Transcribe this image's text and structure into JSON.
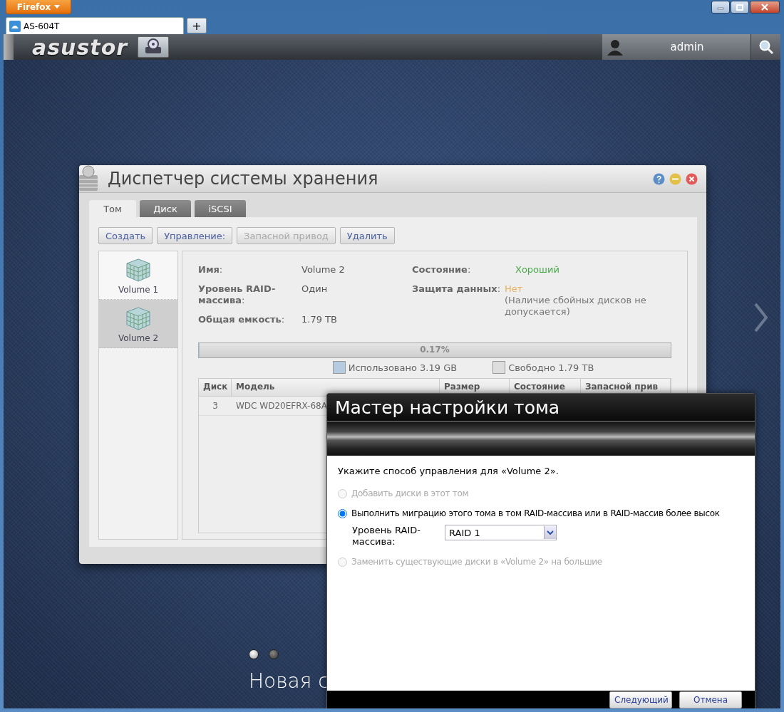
{
  "browser": {
    "menu_button": "Firefox",
    "tabs": [
      {
        "label": "AS-604T",
        "selected": true
      }
    ],
    "new_tab": "+"
  },
  "topbar": {
    "logo": "asustor",
    "user": "admin"
  },
  "storage_window": {
    "title": "Диспетчер системы хранения",
    "tabs": [
      {
        "label": "Том",
        "selected": true
      },
      {
        "label": "Диск",
        "selected": false
      },
      {
        "label": "iSCSI",
        "selected": false
      }
    ],
    "toolbar": [
      {
        "label": "Создать",
        "disabled": false
      },
      {
        "label": "Управление:",
        "disabled": false
      },
      {
        "label": "Запасной привод",
        "disabled": true
      },
      {
        "label": "Удалить",
        "disabled": false
      }
    ],
    "volumes": [
      {
        "label": "Volume 1",
        "selected": false
      },
      {
        "label": "Volume 2",
        "selected": true
      }
    ],
    "details_left": [
      {
        "label": "**Имя**:",
        "value": "Volume 2"
      },
      {
        "label": "**Уровень RAID-массива**:",
        "value": "Один"
      },
      {
        "label": "**Общая емкость**:",
        "value": "1.79 TB"
      }
    ],
    "details_right": [
      {
        "label": "**Состояние**:",
        "value": "Хороший",
        "color": "#4aa84a"
      },
      {
        "label": "**Защита данных**:",
        "value": "Нет",
        "color": "#e8b060",
        "note": "(Наличие сбойных дисков не допускается)"
      }
    ],
    "usage": {
      "level": 0.0017,
      "percent": "0.17%",
      "used": "Использовано 3.19 GB",
      "free": "Свободно 1.79 TB"
    },
    "table": {
      "columns": [
        "Диск",
        "Модель",
        "Размер",
        "Состояние",
        "Запасной прив"
      ],
      "rows": [
        [
          "3",
          "WDC WD20EFRX-68A"
        ]
      ]
    }
  },
  "wizard": {
    "title": "Мастер настройки тома",
    "prompt": "Укажите способ управления для «Volume 2».",
    "options": [
      {
        "label": "Добавить диски в этот том",
        "selected": false,
        "disabled": true
      },
      {
        "label": "Выполнить миграцию этого тома в том RAID-массива или в RAID-массив более высок",
        "selected": true,
        "disabled": false,
        "field": {
          "label": "Уровень RAID-массива:",
          "value": "RAID 1"
        }
      },
      {
        "label": "Заменить существующие диски в «Volume 2» на большие",
        "selected": false,
        "disabled": true
      }
    ],
    "buttons": [
      "Следующий",
      "Отмена"
    ]
  },
  "carousel": {
    "dots": [
      {
        "selected": true
      },
      {
        "selected": false
      }
    ],
    "caption": "Новая с"
  }
}
